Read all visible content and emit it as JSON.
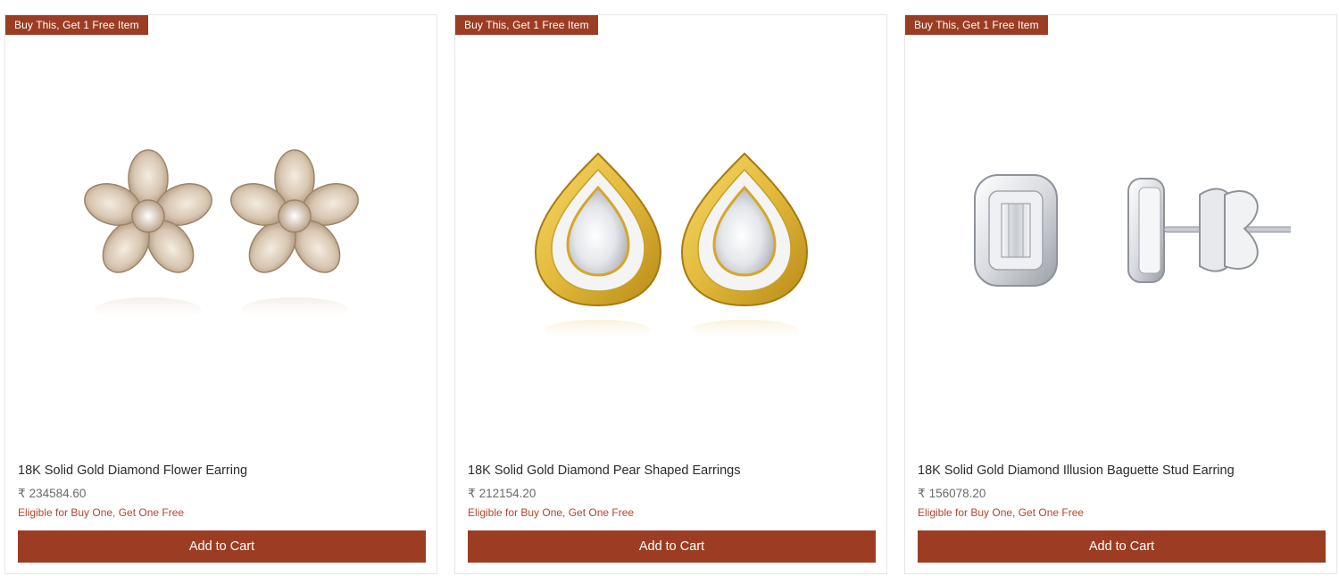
{
  "products": [
    {
      "badge": "Buy This, Get 1 Free Item",
      "image": "flower-diamond-earrings",
      "title": "18K Solid Gold Diamond Flower Earring",
      "currency": "₹",
      "price": "234584.60",
      "promo": "Eligible for Buy One, Get One Free",
      "cta": "Add to Cart"
    },
    {
      "badge": "Buy This, Get 1 Free Item",
      "image": "pear-halo-diamond-earrings",
      "title": "18K Solid Gold Diamond Pear Shaped Earrings",
      "currency": "₹",
      "price": "212154.20",
      "promo": "Eligible for Buy One, Get One Free",
      "cta": "Add to Cart"
    },
    {
      "badge": "Buy This, Get 1 Free Item",
      "image": "illusion-baguette-stud-earrings",
      "title": "18K Solid Gold Diamond Illusion Baguette Stud Earring",
      "currency": "₹",
      "price": "156078.20",
      "promo": "Eligible for Buy One, Get One Free",
      "cta": "Add to Cart"
    }
  ],
  "colors": {
    "accent": "#9c3d23",
    "promo_text": "#b5452a",
    "gold": "#e2b93b",
    "rose_gold": "#c9a98a",
    "white_gold": "#d9dbe0"
  }
}
